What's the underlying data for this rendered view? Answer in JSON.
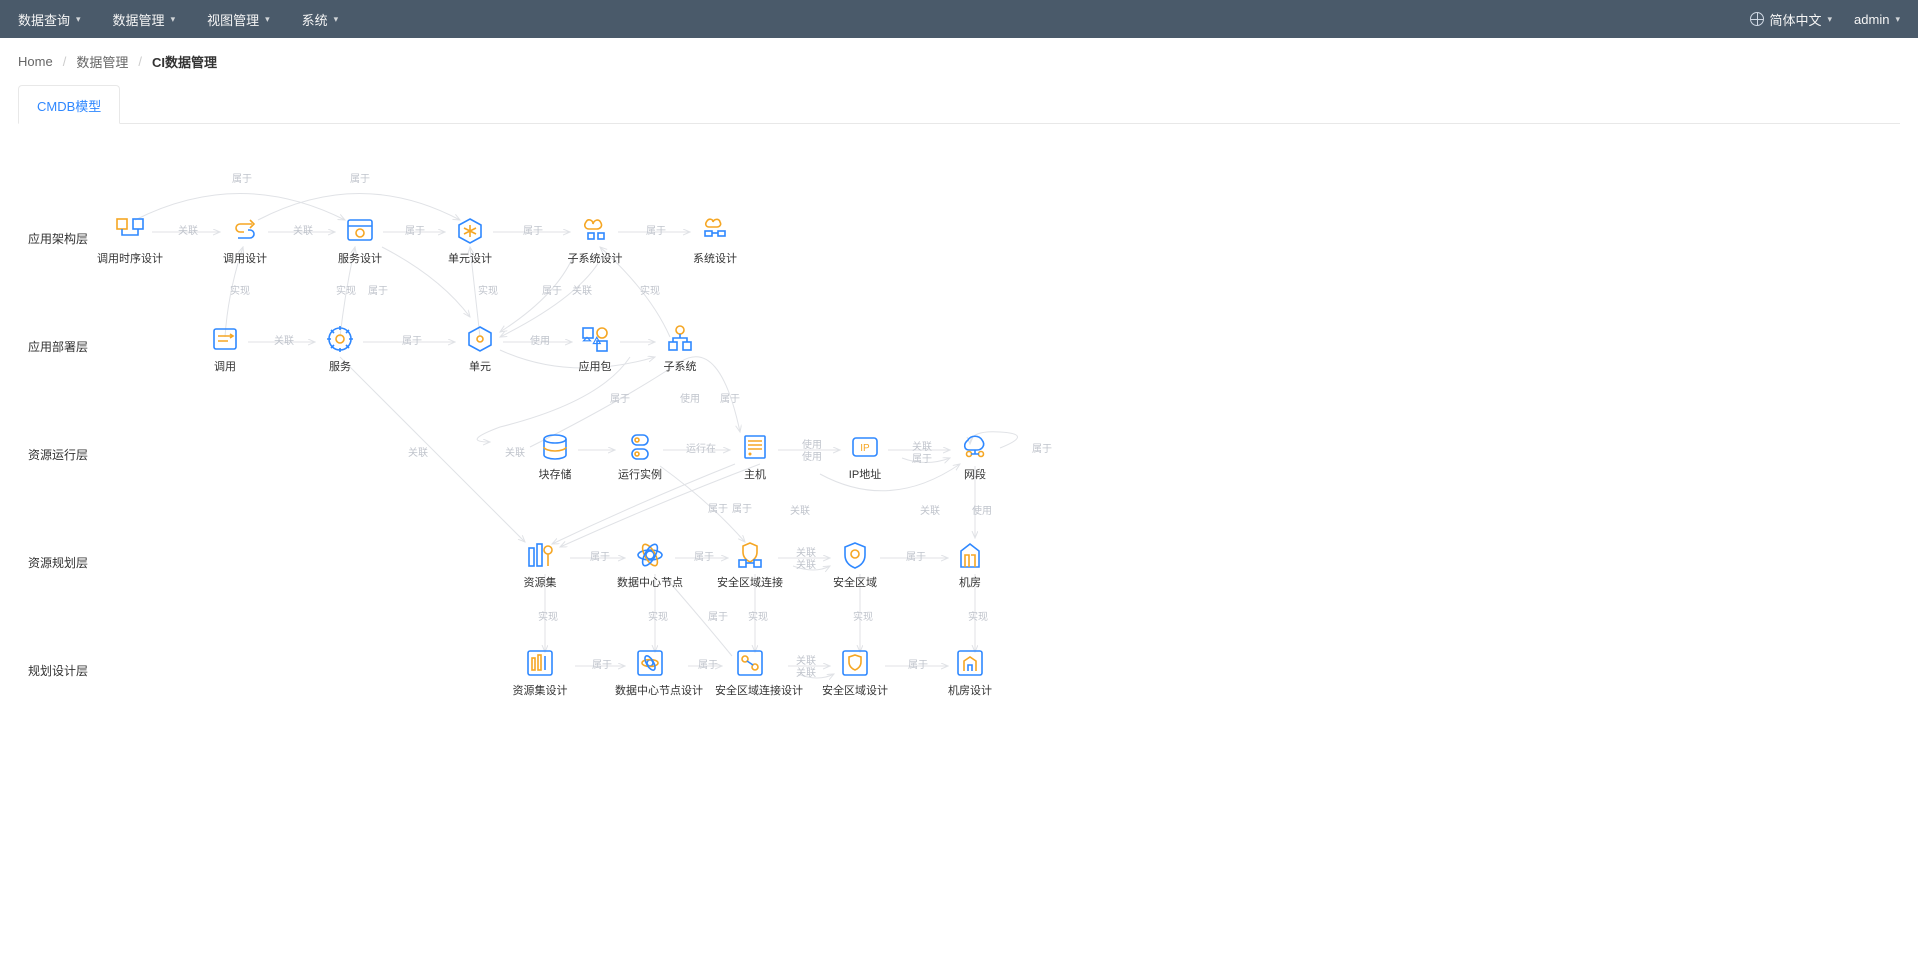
{
  "topnav": {
    "items": [
      {
        "label": "数据查询"
      },
      {
        "label": "数据管理"
      },
      {
        "label": "视图管理"
      },
      {
        "label": "系统"
      }
    ],
    "language": "简体中文",
    "user": "admin"
  },
  "breadcrumb": {
    "home": "Home",
    "mid": "数据管理",
    "current": "CI数据管理"
  },
  "tab": {
    "active": "CMDB模型"
  },
  "layers": {
    "l1": "应用架构层",
    "l2": "应用部署层",
    "l3": "资源运行层",
    "l4": "资源规划层",
    "l5": "规划设计层"
  },
  "nodes": {
    "n_app_seq": "调用时序设计",
    "n_app_call": "调用设计",
    "n_app_svc": "服务设计",
    "n_unit_d": "单元设计",
    "n_subsys_d": "子系统设计",
    "n_sys_d": "系统设计",
    "n_call": "调用",
    "n_svc": "服务",
    "n_unit": "单元",
    "n_apppkg": "应用包",
    "n_subsys": "子系统",
    "n_block": "块存储",
    "n_inst": "运行实例",
    "n_host": "主机",
    "n_ip": "IP地址",
    "n_segment": "网段",
    "n_resset": "资源集",
    "n_dcnode": "数据中心节点",
    "n_seclink": "安全区域连接",
    "n_seczone": "安全区域",
    "n_room": "机房",
    "n_resset_d": "资源集设计",
    "n_dcnode_d": "数据中心节点设计",
    "n_seclink_d": "安全区域连接设计",
    "n_seczone_d": "安全区域设计",
    "n_room_d": "机房设计"
  },
  "edge_labels": {
    "guanlian": "关联",
    "shuyu": "属于",
    "shixian": "实现",
    "shiyong": "使用",
    "yunxingzai": "运行在"
  },
  "diagram_data": {
    "type": "directed-graph",
    "layers_order": [
      "应用架构层",
      "应用部署层",
      "资源运行层",
      "资源规划层",
      "规划设计层"
    ],
    "nodes": [
      {
        "id": "调用时序设计",
        "layer": "应用架构层"
      },
      {
        "id": "调用设计",
        "layer": "应用架构层"
      },
      {
        "id": "服务设计",
        "layer": "应用架构层"
      },
      {
        "id": "单元设计",
        "layer": "应用架构层"
      },
      {
        "id": "子系统设计",
        "layer": "应用架构层"
      },
      {
        "id": "系统设计",
        "layer": "应用架构层"
      },
      {
        "id": "调用",
        "layer": "应用部署层"
      },
      {
        "id": "服务",
        "layer": "应用部署层"
      },
      {
        "id": "单元",
        "layer": "应用部署层"
      },
      {
        "id": "应用包",
        "layer": "应用部署层"
      },
      {
        "id": "子系统",
        "layer": "应用部署层"
      },
      {
        "id": "块存储",
        "layer": "资源运行层"
      },
      {
        "id": "运行实例",
        "layer": "资源运行层"
      },
      {
        "id": "主机",
        "layer": "资源运行层"
      },
      {
        "id": "IP地址",
        "layer": "资源运行层"
      },
      {
        "id": "网段",
        "layer": "资源运行层"
      },
      {
        "id": "资源集",
        "layer": "资源规划层"
      },
      {
        "id": "数据中心节点",
        "layer": "资源规划层"
      },
      {
        "id": "安全区域连接",
        "layer": "资源规划层"
      },
      {
        "id": "安全区域",
        "layer": "资源规划层"
      },
      {
        "id": "机房",
        "layer": "资源规划层"
      },
      {
        "id": "资源集设计",
        "layer": "规划设计层"
      },
      {
        "id": "数据中心节点设计",
        "layer": "规划设计层"
      },
      {
        "id": "安全区域连接设计",
        "layer": "规划设计层"
      },
      {
        "id": "安全区域设计",
        "layer": "规划设计层"
      },
      {
        "id": "机房设计",
        "layer": "规划设计层"
      }
    ],
    "edges": [
      {
        "from": "调用时序设计",
        "to": "调用设计",
        "label": "关联"
      },
      {
        "from": "调用设计",
        "to": "服务设计",
        "label": "关联"
      },
      {
        "from": "服务设计",
        "to": "单元设计",
        "label": "属于"
      },
      {
        "from": "单元设计",
        "to": "子系统设计",
        "label": "属于"
      },
      {
        "from": "子系统设计",
        "to": "系统设计",
        "label": "属于"
      },
      {
        "from": "调用设计",
        "to": "单元设计",
        "label": "属于"
      },
      {
        "from": "调用时序设计",
        "to": "服务设计",
        "label": "属于"
      },
      {
        "from": "调用",
        "to": "调用设计",
        "label": "实现"
      },
      {
        "from": "服务",
        "to": "服务设计",
        "label": "实现"
      },
      {
        "from": "服务设计",
        "to": "单元设计",
        "label": "属于"
      },
      {
        "from": "单元",
        "to": "单元设计",
        "label": "实现"
      },
      {
        "from": "应用包",
        "to": "单元设计",
        "label": "属于"
      },
      {
        "from": "应用包",
        "to": "单元设计",
        "label": "关联"
      },
      {
        "from": "子系统",
        "to": "子系统设计",
        "label": "实现"
      },
      {
        "from": "调用",
        "to": "服务",
        "label": "关联"
      },
      {
        "from": "服务",
        "to": "单元",
        "label": "属于"
      },
      {
        "from": "单元",
        "to": "应用包",
        "label": "使用"
      },
      {
        "from": "单元",
        "to": "子系统",
        "label": "属于"
      },
      {
        "from": "应用包",
        "to": "子系统",
        "label": "属于"
      },
      {
        "from": "运行实例",
        "to": "单元",
        "label": "属于"
      },
      {
        "from": "单元",
        "to": "主机",
        "label": "使用"
      },
      {
        "from": "单元",
        "to": "IP地址",
        "label": "属于"
      },
      {
        "from": "块存储",
        "to": "主机",
        "label": "关联"
      },
      {
        "from": "运行实例",
        "to": "主机",
        "label": "运行在"
      },
      {
        "from": "主机",
        "to": "IP地址",
        "label": "使用"
      },
      {
        "from": "主机",
        "to": "IP地址",
        "label": "使用"
      },
      {
        "from": "IP地址",
        "to": "网段",
        "label": "关联"
      },
      {
        "from": "IP地址",
        "to": "网段",
        "label": "属于"
      },
      {
        "from": "网段",
        "to": "网段",
        "label": "属于"
      },
      {
        "from": "服务",
        "to": "资源集",
        "label": "关联"
      },
      {
        "from": "主机",
        "to": "资源集",
        "label": "属于"
      },
      {
        "from": "主机",
        "to": "资源集",
        "label": "属于"
      },
      {
        "from": "网段",
        "to": "数据中心节点",
        "label": "关联"
      },
      {
        "from": "安全区域连接",
        "to": "网段",
        "label": "关联"
      },
      {
        "from": "机房",
        "to": "网段",
        "label": "使用"
      },
      {
        "from": "资源集",
        "to": "数据中心节点",
        "label": "属于"
      },
      {
        "from": "数据中心节点",
        "to": "安全区域连接",
        "label": "属于"
      },
      {
        "from": "安全区域连接",
        "to": "安全区域",
        "label": "关联"
      },
      {
        "from": "安全区域连接",
        "to": "安全区域",
        "label": "关联"
      },
      {
        "from": "安全区域",
        "to": "机房",
        "label": "属于"
      },
      {
        "from": "资源集",
        "to": "资源集设计",
        "label": "实现"
      },
      {
        "from": "数据中心节点",
        "to": "数据中心节点设计",
        "label": "实现"
      },
      {
        "from": "安全区域连接",
        "to": "安全区域连接设计",
        "label": "实现"
      },
      {
        "from": "安全区域连接设计",
        "to": "数据中心节点",
        "label": "属于"
      },
      {
        "from": "安全区域",
        "to": "安全区域设计",
        "label": "实现"
      },
      {
        "from": "机房",
        "to": "机房设计",
        "label": "实现"
      },
      {
        "from": "资源集设计",
        "to": "数据中心节点设计",
        "label": "属于"
      },
      {
        "from": "数据中心节点设计",
        "to": "安全区域连接设计",
        "label": "属于"
      },
      {
        "from": "安全区域连接设计",
        "to": "安全区域设计",
        "label": "关联"
      },
      {
        "from": "安全区域连接设计",
        "to": "安全区域设计",
        "label": "关联"
      },
      {
        "from": "安全区域设计",
        "to": "机房设计",
        "label": "属于"
      }
    ]
  },
  "colors": {
    "accent": "#2f88ff",
    "gold": "#f5a623",
    "header": "#4a5a6a",
    "edge": "#e0e2e6",
    "edgeLabel": "#c0c4cc"
  }
}
